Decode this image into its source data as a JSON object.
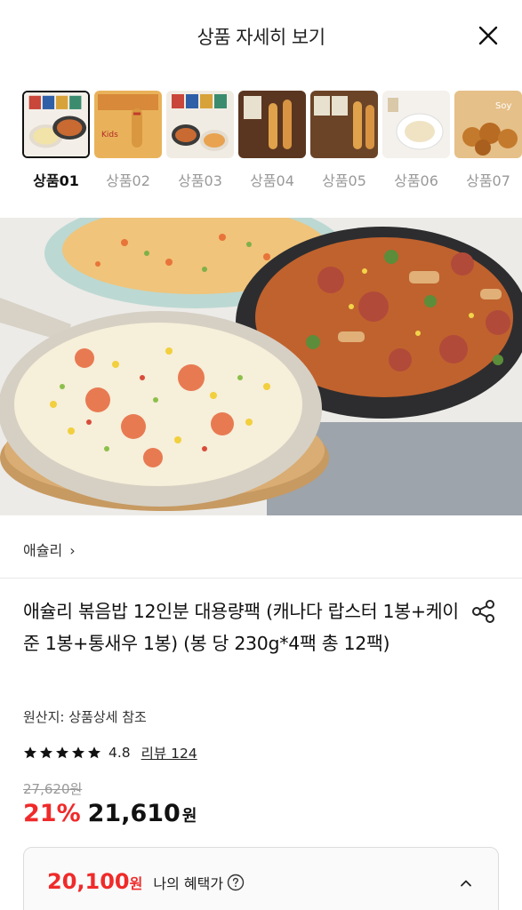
{
  "header": {
    "title": "상품 자세히 보기"
  },
  "gallery": {
    "thumbnails": [
      {
        "label": "상품01",
        "active": true
      },
      {
        "label": "상품02",
        "active": false
      },
      {
        "label": "상품03",
        "active": false
      },
      {
        "label": "상품04",
        "active": false
      },
      {
        "label": "상품05",
        "active": false
      },
      {
        "label": "상품06",
        "active": false
      },
      {
        "label": "상품07",
        "active": false
      }
    ]
  },
  "product": {
    "brand": "애슐리",
    "brand_chevron": "›",
    "title": "애슐리 볶음밥 12인분 대용량팩 (캐나다 랍스터 1봉+케이준 1봉+통새우 1봉) (봉 당 230g*4팩 총 12팩)",
    "origin": "원산지: 상품상세 참조",
    "rating": "4.8",
    "stars": 5,
    "review_label": "리뷰 124",
    "original_price": "27,620원",
    "discount": "21%",
    "sale_price": "21,610",
    "currency": "원"
  },
  "benefit": {
    "price": "20,100",
    "currency": "원",
    "label": "나의 혜택가"
  },
  "colors": {
    "accent_red": "#f02a2a"
  }
}
